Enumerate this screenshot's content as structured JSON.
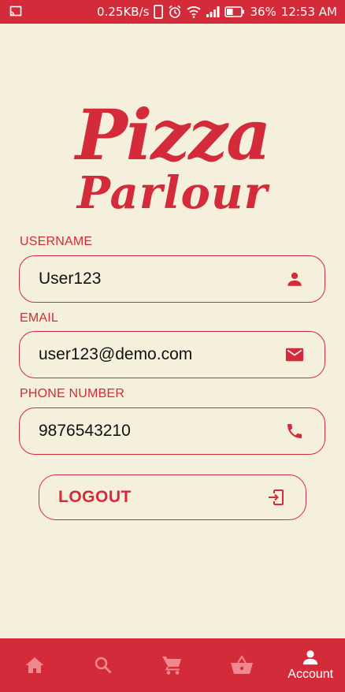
{
  "status_bar": {
    "speed": "0.25KB/s",
    "battery": "36%",
    "time": "12:53 AM"
  },
  "logo": {
    "line1": "Pizza",
    "line2": "Parlour"
  },
  "form": {
    "username": {
      "label": "USERNAME",
      "value": "User123",
      "icon": "person-icon"
    },
    "email": {
      "label": "EMAIL",
      "value": "user123@demo.com",
      "icon": "mail-icon"
    },
    "phone": {
      "label": "PHONE NUMBER",
      "value": "9876543210",
      "icon": "phone-icon"
    }
  },
  "logout": {
    "label": "LOGOUT",
    "icon": "exit-icon"
  },
  "bottom_nav": {
    "items": [
      {
        "icon": "home-icon"
      },
      {
        "icon": "search-icon"
      },
      {
        "icon": "cart-icon"
      },
      {
        "icon": "basket-icon"
      },
      {
        "icon": "account-icon",
        "label": "Account",
        "active": true
      }
    ]
  },
  "colors": {
    "primary": "#D42B3A",
    "background": "#F4F0DC",
    "inactive_icon": "#F08890"
  }
}
